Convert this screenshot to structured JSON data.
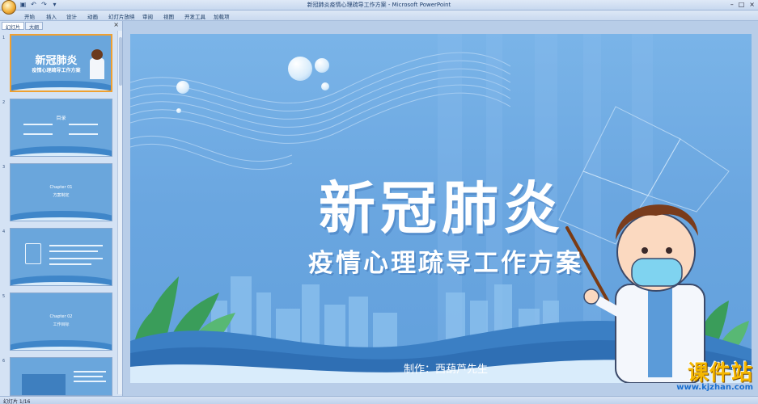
{
  "window": {
    "title": "新冠肺炎疫情心理疏导工作方案 - Microsoft PowerPoint"
  },
  "ribbon": {
    "tabs": [
      "开始",
      "插入",
      "设计",
      "动画",
      "幻灯片放映",
      "审阅",
      "视图",
      "开发工具",
      "加载项"
    ]
  },
  "left_pane": {
    "tabs": [
      "幻灯片",
      "大纲"
    ],
    "thumbnails": [
      {
        "number": "1",
        "title": "新冠肺炎",
        "subtitle": "疫情心理疏导工作方案"
      },
      {
        "number": "2",
        "title": "目录",
        "subtitle": ""
      },
      {
        "number": "3",
        "title": "Chapter 01",
        "subtitle": "方案制定"
      },
      {
        "number": "4",
        "title": "",
        "subtitle": ""
      },
      {
        "number": "5",
        "title": "Chapter 02",
        "subtitle": "工作目标"
      },
      {
        "number": "6",
        "title": "",
        "subtitle": ""
      }
    ]
  },
  "slide": {
    "title": "新冠肺炎",
    "subtitle": "疫情心理疏导工作方案",
    "author": "制作：西葫芦先生"
  },
  "status_bar": {
    "slide_counter": "幻灯片 1/16"
  },
  "watermark": {
    "brand": "课件站",
    "url": "www.kjzhan.com"
  },
  "colors": {
    "slide_bg": "#6aa6e0",
    "accent": "#f5b800"
  }
}
